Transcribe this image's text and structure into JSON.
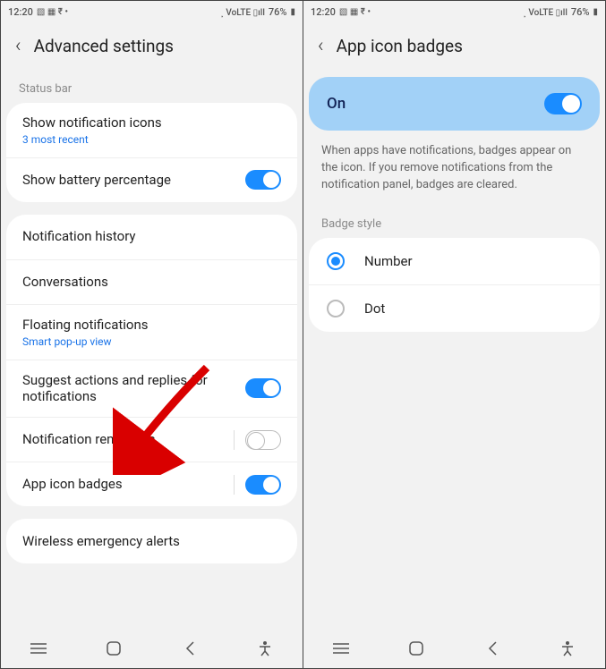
{
  "statusbar": {
    "time": "12:20",
    "battery": "76%"
  },
  "left": {
    "title": "Advanced settings",
    "section1_label": "Status bar",
    "show_notif_icons": {
      "label": "Show notification icons",
      "sub": "3 most recent"
    },
    "show_battery_pct": {
      "label": "Show battery percentage"
    },
    "notif_history": {
      "label": "Notification history"
    },
    "conversations": {
      "label": "Conversations"
    },
    "floating": {
      "label": "Floating notifications",
      "sub": "Smart pop-up view"
    },
    "suggest": {
      "label": "Suggest actions and replies for notifications"
    },
    "reminders": {
      "label": "Notification reminders"
    },
    "app_icon_badges": {
      "label": "App icon badges"
    },
    "wireless_alerts": {
      "label": "Wireless emergency alerts"
    }
  },
  "right": {
    "title": "App icon badges",
    "on_label": "On",
    "desc": "When apps have notifications, badges appear on the icon. If you remove notifications from the notification panel, badges are cleared.",
    "badge_style_label": "Badge style",
    "opt_number": "Number",
    "opt_dot": "Dot"
  }
}
